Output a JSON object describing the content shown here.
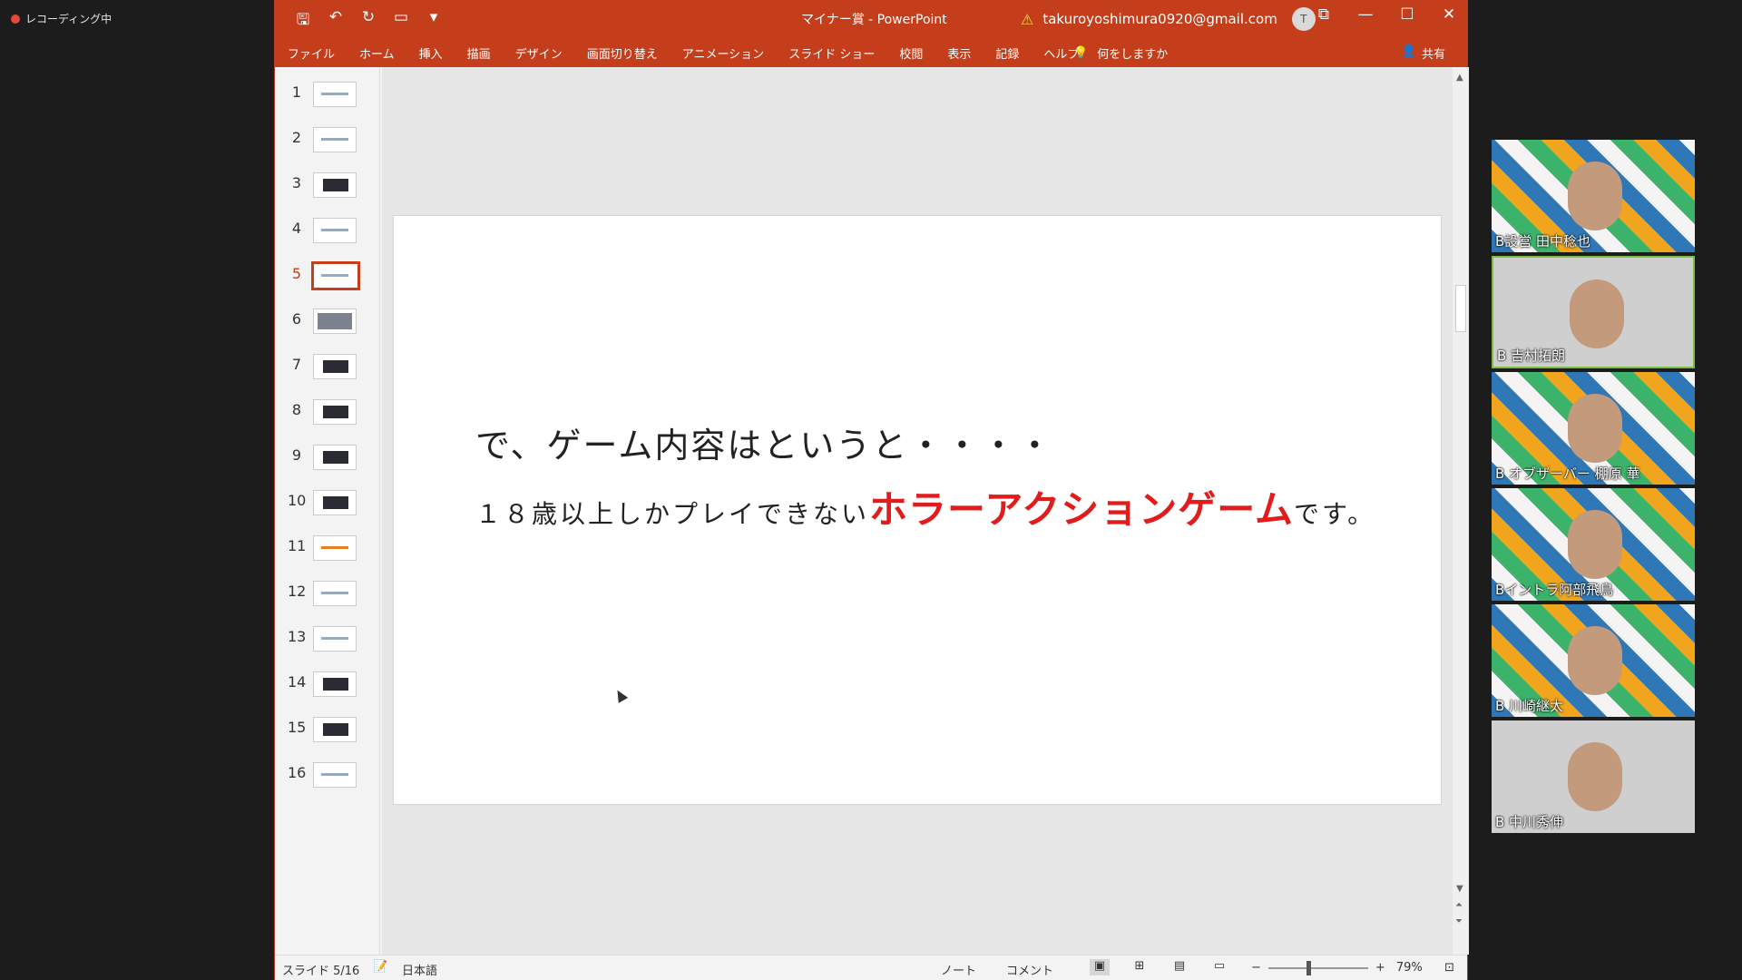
{
  "recording": {
    "label": "レコーディング中"
  },
  "window": {
    "title": "マイナー賞 - PowerPoint",
    "account_email": "takuroyoshimura0920@gmail.com",
    "avatar_initial": "T"
  },
  "ribbon": {
    "tabs": [
      "ファイル",
      "ホーム",
      "挿入",
      "描画",
      "デザイン",
      "画面切り替え",
      "アニメーション",
      "スライド ショー",
      "校閲",
      "表示",
      "記録",
      "ヘルプ"
    ],
    "tell_me": "何をしますか",
    "share": "共有"
  },
  "thumbnails": {
    "active_index": 5,
    "items": [
      "1",
      "2",
      "3",
      "4",
      "5",
      "6",
      "7",
      "8",
      "9",
      "10",
      "11",
      "12",
      "13",
      "14",
      "15",
      "16"
    ]
  },
  "slide": {
    "line1": "で、ゲーム内容はというと・・・・",
    "line2_prefix": "１８歳以上しかプレイできない",
    "line2_highlight": "ホラーアクションゲーム",
    "line2_suffix": "です。"
  },
  "status": {
    "slide_info": "スライド 5/16",
    "language": "日本語",
    "notes": "ノート",
    "comments": "コメント",
    "zoom": "79%"
  },
  "participants": [
    {
      "name": "B設営 田中稔也"
    },
    {
      "name": "B 吉村拓朗"
    },
    {
      "name": "B オブザーバー 棚原 華"
    },
    {
      "name": "Bイントラ阿部飛鳥"
    },
    {
      "name": "B 川崎継太"
    },
    {
      "name": "B 中川秀伸"
    }
  ],
  "colors": {
    "accent": "#c43e1c",
    "highlight": "#e21c1c",
    "speaking": "#7bc043"
  }
}
